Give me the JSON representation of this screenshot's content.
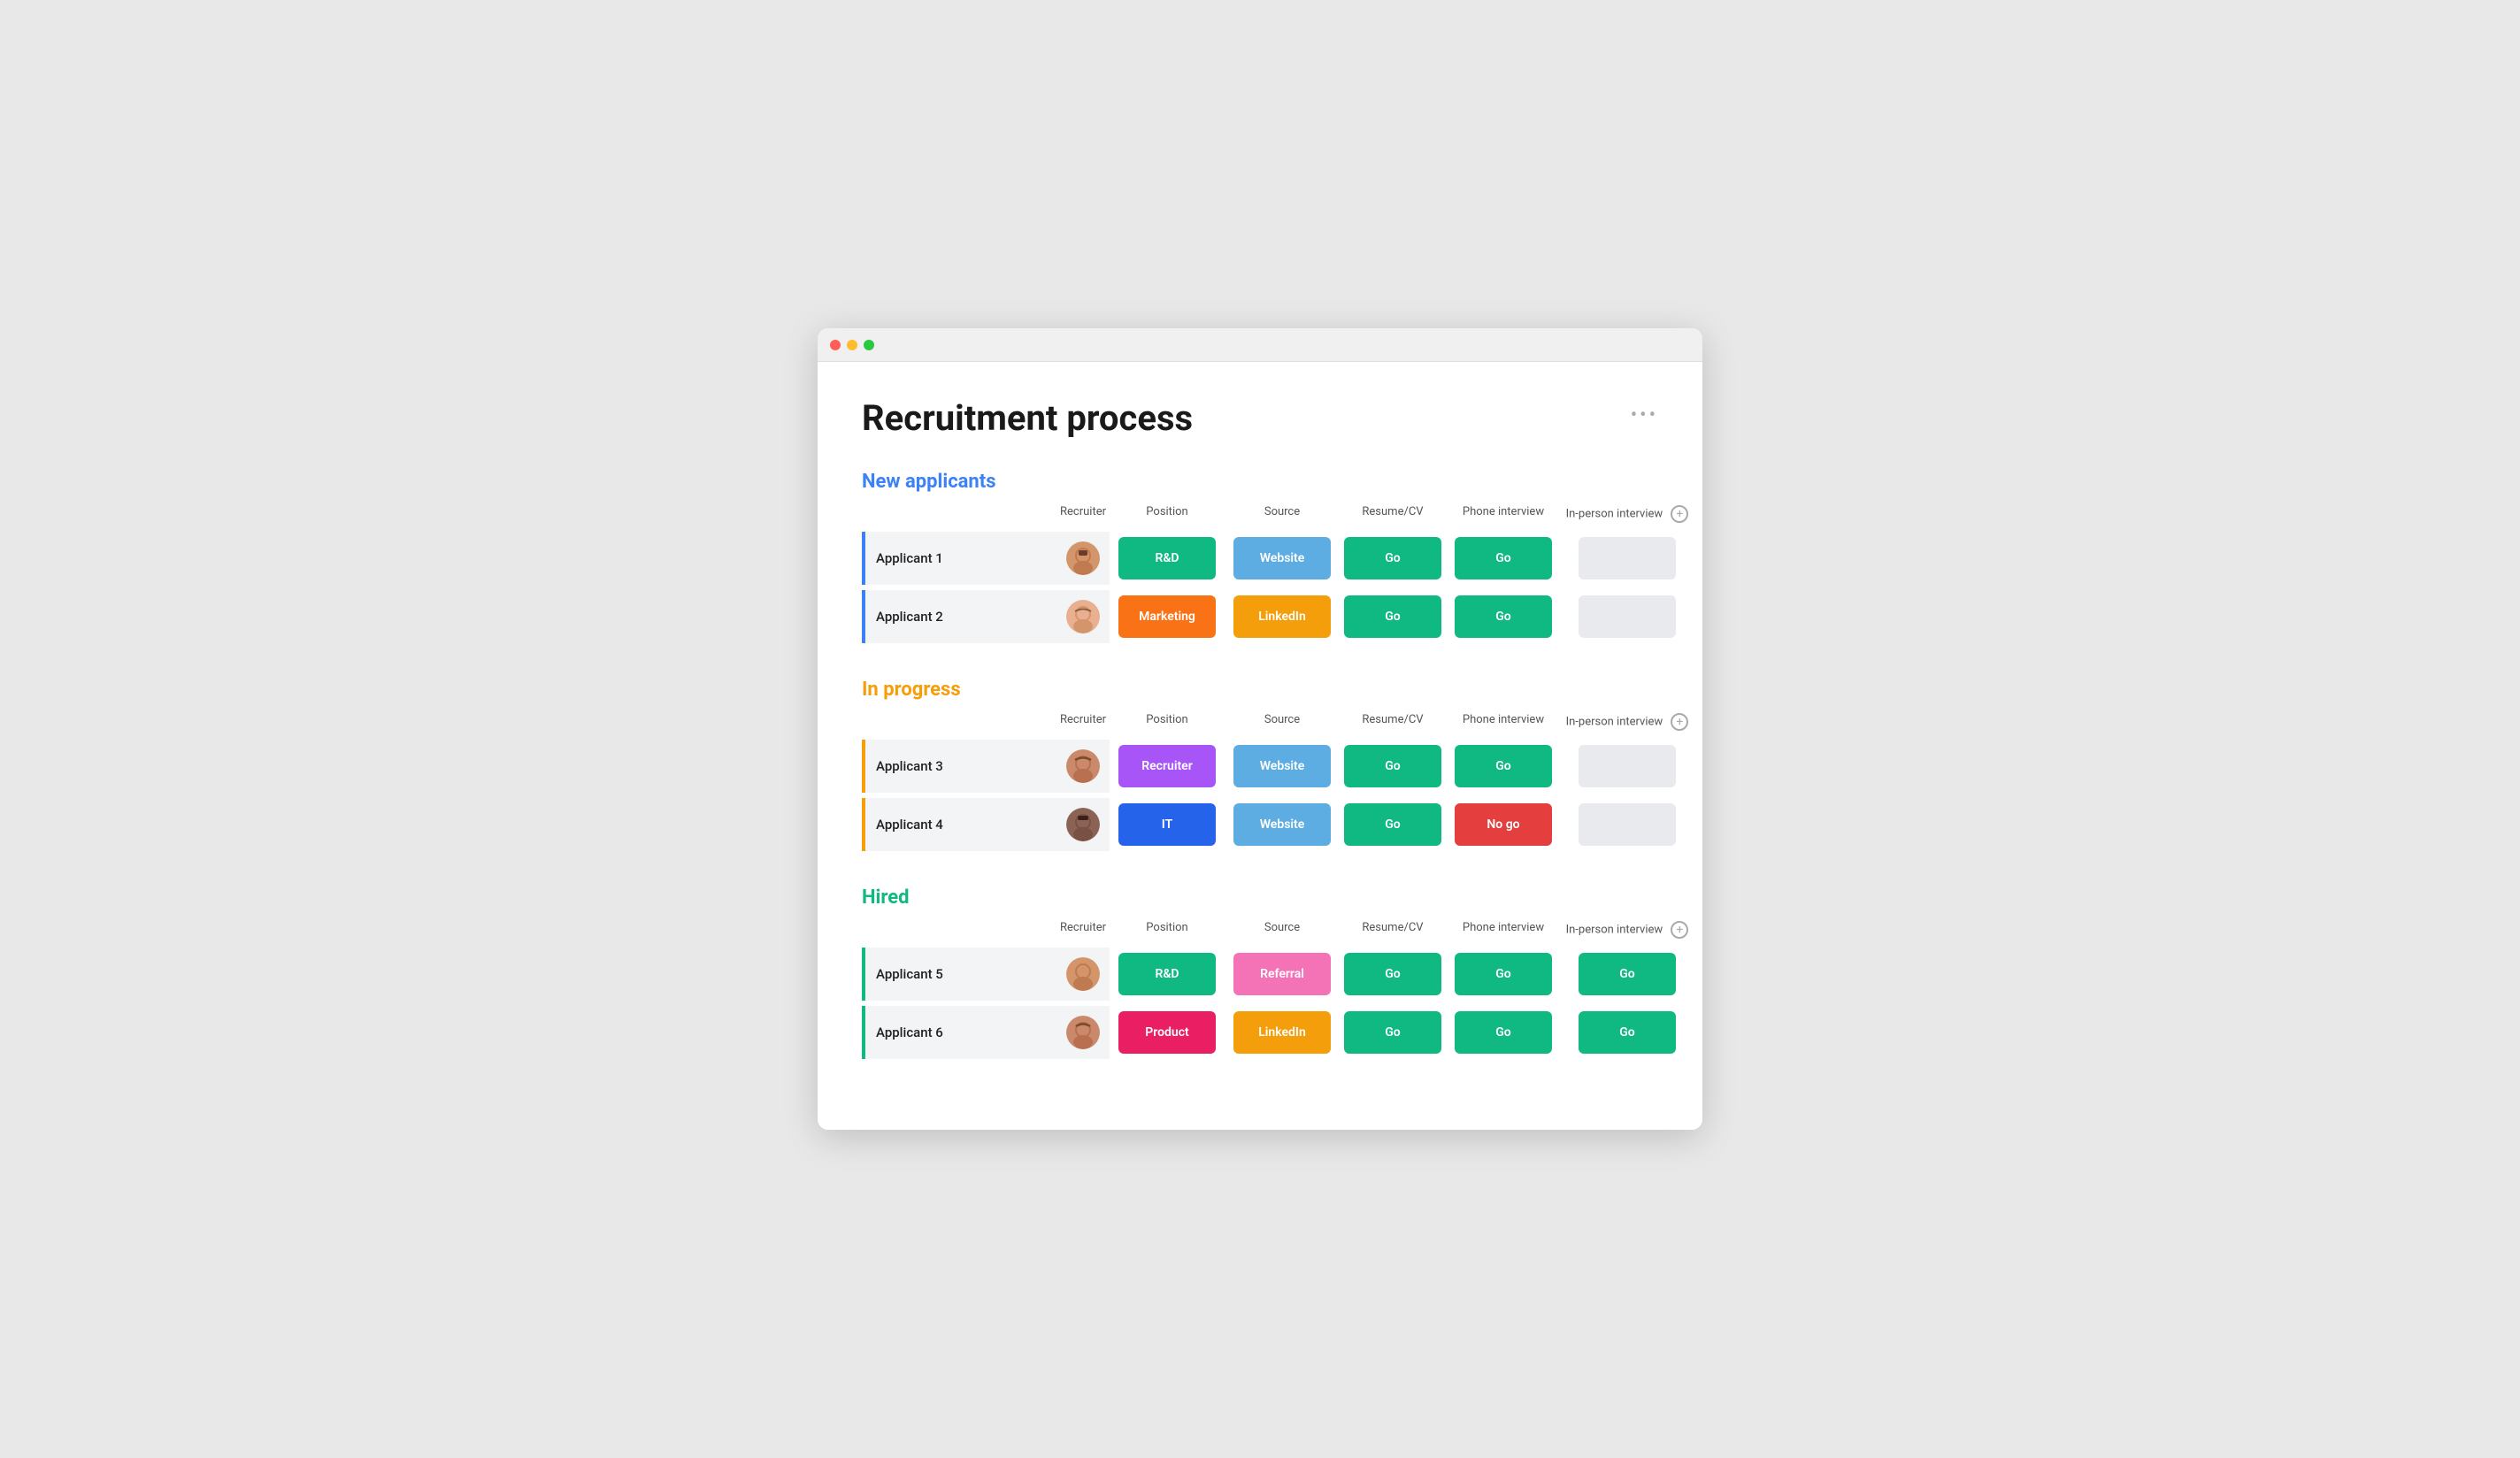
{
  "window": {
    "title": "Recruitment process"
  },
  "page": {
    "title": "Recruitment process",
    "more_label": "•••"
  },
  "columns": {
    "recruiter": "Recruiter",
    "position": "Position",
    "source": "Source",
    "resume_cv": "Resume/CV",
    "phone_interview": "Phone interview",
    "in_person_interview": "In-person interview"
  },
  "sections": [
    {
      "id": "new-applicants",
      "title": "New applicants",
      "color_class": "blue",
      "border_class": "border-blue",
      "rows": [
        {
          "name": "Applicant 1",
          "avatar_id": "1",
          "position": {
            "label": "R&D",
            "color": "tag-green"
          },
          "source": {
            "label": "Website",
            "color": "tag-teal"
          },
          "resume": {
            "label": "Go",
            "color": "tag-green"
          },
          "phone": {
            "label": "Go",
            "color": "tag-green"
          },
          "in_person": {
            "label": "",
            "color": "tag-gray"
          }
        },
        {
          "name": "Applicant 2",
          "avatar_id": "2",
          "position": {
            "label": "Marketing",
            "color": "tag-orange-pos"
          },
          "source": {
            "label": "LinkedIn",
            "color": "tag-amber"
          },
          "resume": {
            "label": "Go",
            "color": "tag-green"
          },
          "phone": {
            "label": "Go",
            "color": "tag-green"
          },
          "in_person": {
            "label": "",
            "color": "tag-gray"
          }
        }
      ]
    },
    {
      "id": "in-progress",
      "title": "In progress",
      "color_class": "orange",
      "border_class": "border-orange",
      "rows": [
        {
          "name": "Applicant 3",
          "avatar_id": "3",
          "position": {
            "label": "Recruiter",
            "color": "tag-purple"
          },
          "source": {
            "label": "Website",
            "color": "tag-teal"
          },
          "resume": {
            "label": "Go",
            "color": "tag-green"
          },
          "phone": {
            "label": "Go",
            "color": "tag-green"
          },
          "in_person": {
            "label": "",
            "color": "tag-gray"
          }
        },
        {
          "name": "Applicant 4",
          "avatar_id": "4",
          "position": {
            "label": "IT",
            "color": "tag-blue"
          },
          "source": {
            "label": "Website",
            "color": "tag-teal"
          },
          "resume": {
            "label": "Go",
            "color": "tag-green"
          },
          "phone": {
            "label": "No go",
            "color": "tag-red"
          },
          "in_person": {
            "label": "",
            "color": "tag-gray"
          }
        }
      ]
    },
    {
      "id": "hired",
      "title": "Hired",
      "color_class": "green",
      "border_class": "border-green",
      "rows": [
        {
          "name": "Applicant 5",
          "avatar_id": "5",
          "position": {
            "label": "R&D",
            "color": "tag-green"
          },
          "source": {
            "label": "Referral",
            "color": "tag-pink"
          },
          "resume": {
            "label": "Go",
            "color": "tag-green"
          },
          "phone": {
            "label": "Go",
            "color": "tag-green"
          },
          "in_person": {
            "label": "Go",
            "color": "tag-green"
          }
        },
        {
          "name": "Applicant 6",
          "avatar_id": "6",
          "position": {
            "label": "Product",
            "color": "tag-crimson"
          },
          "source": {
            "label": "LinkedIn",
            "color": "tag-amber"
          },
          "resume": {
            "label": "Go",
            "color": "tag-green"
          },
          "phone": {
            "label": "Go",
            "color": "tag-green"
          },
          "in_person": {
            "label": "Go",
            "color": "tag-green"
          }
        }
      ]
    }
  ]
}
